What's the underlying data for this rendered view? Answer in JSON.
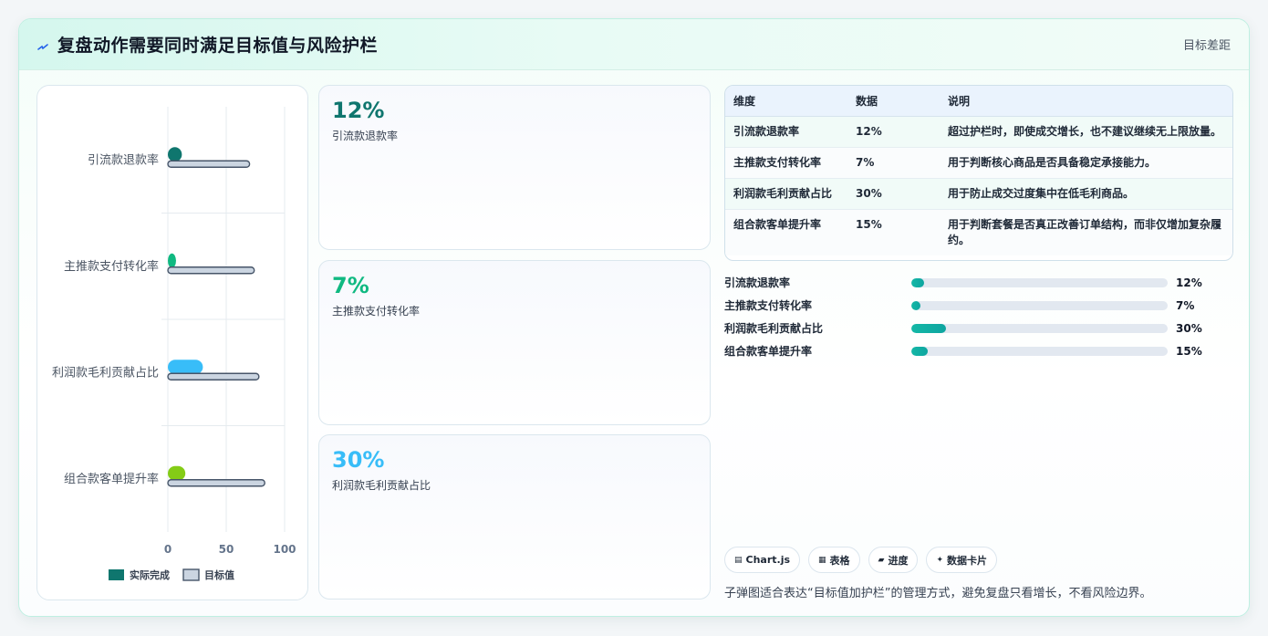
{
  "header": {
    "icon": "bolt-icon",
    "title": "复盘动作需要同时满足目标值与风险护栏",
    "right_label": "目标差距"
  },
  "chart_data": {
    "type": "bar",
    "orientation": "horizontal",
    "categories": [
      "引流款退款率",
      "主推款支付转化率",
      "利润款毛利贡献占比",
      "组合款客单提升率"
    ],
    "series": [
      {
        "name": "实际完成",
        "values": [
          12,
          7,
          30,
          15
        ],
        "colors": [
          "#0f766e",
          "#10b981",
          "#38bdf8",
          "#84cc16"
        ]
      },
      {
        "name": "目标值",
        "values": [
          70,
          74,
          78,
          83
        ],
        "color": "#cbd5e1"
      }
    ],
    "xlim": [
      0,
      100
    ],
    "xticks": [
      "0",
      "50",
      "100"
    ],
    "legend_position": "bottom",
    "grid": true
  },
  "cards": [
    {
      "value": "12%",
      "label": "引流款退款率",
      "color": "#0f766e"
    },
    {
      "value": "7%",
      "label": "主推款支付转化率",
      "color": "#10b981"
    },
    {
      "value": "30%",
      "label": "利润款毛利贡献占比",
      "color": "#38bdf8"
    }
  ],
  "table": {
    "headers": [
      "维度",
      "数据",
      "说明"
    ],
    "rows": [
      [
        "引流款退款率",
        "12%",
        "超过护栏时，即使成交增长，也不建议继续无上限放量。"
      ],
      [
        "主推款支付转化率",
        "7%",
        "用于判断核心商品是否具备稳定承接能力。"
      ],
      [
        "利润款毛利贡献占比",
        "30%",
        "用于防止成交过度集中在低毛利商品。"
      ],
      [
        "组合款客单提升率",
        "15%",
        "用于判断套餐是否真正改善订单结构，而非仅增加复杂履约。"
      ]
    ]
  },
  "progress": [
    {
      "label": "引流款退款率",
      "value": "12%",
      "fraction": 0.05
    },
    {
      "label": "主推款支付转化率",
      "value": "7%",
      "fraction": 0.035
    },
    {
      "label": "利润款毛利贡献占比",
      "value": "30%",
      "fraction": 0.135
    },
    {
      "label": "组合款客单提升率",
      "value": "15%",
      "fraction": 0.065
    }
  ],
  "tags": [
    {
      "icon": "chart-icon",
      "label": "Chart.js"
    },
    {
      "icon": "table-icon",
      "label": "表格"
    },
    {
      "icon": "progress-icon",
      "label": "进度"
    },
    {
      "icon": "data-card-icon",
      "label": "数据卡片"
    }
  ],
  "footnote": "子弹图适合表达“目标值加护栏”的管理方式，避免复盘只看增长，不看风险边界。"
}
